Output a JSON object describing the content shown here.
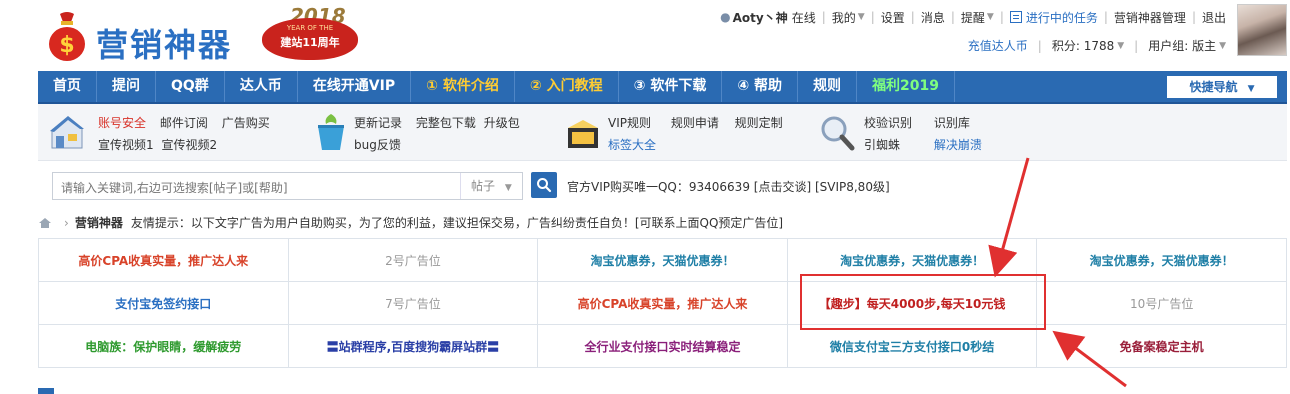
{
  "site": {
    "title": "营销神器",
    "badge_year": "2018",
    "badge_line1": "YEAR OF THE",
    "badge_line2": "建站11周年"
  },
  "topbar": {
    "username": "Aoty丶神",
    "online": "在线",
    "my": "我的",
    "settings": "设置",
    "messages": "消息",
    "remind": "提醒",
    "tasks": "进行中的任务",
    "manage": "营销神器管理",
    "logout": "退出"
  },
  "topbar2": {
    "recharge": "充值达人币",
    "points": "积分: 1788",
    "group": "用户组: 版主"
  },
  "nav": {
    "items": [
      {
        "label": "首页",
        "style": "white"
      },
      {
        "label": "提问",
        "style": "white"
      },
      {
        "label": "QQ群",
        "style": "white"
      },
      {
        "label": "达人币",
        "style": "white"
      },
      {
        "label": "在线开通VIP",
        "style": "white"
      },
      {
        "label": "① 软件介绍",
        "style": "yellow"
      },
      {
        "label": "② 入门教程",
        "style": "yellow"
      },
      {
        "label": "③ 软件下载",
        "style": "white"
      },
      {
        "label": "④ 帮助",
        "style": "white"
      },
      {
        "label": "规则",
        "style": "white"
      },
      {
        "label": "福利2019",
        "style": "green"
      }
    ],
    "quick": "快捷导航"
  },
  "subnav": {
    "g1_row1": [
      "账号安全",
      "邮件订阅",
      "广告购买"
    ],
    "g1_row2": [
      "宣传视频1",
      "宣传视频2"
    ],
    "g2_row1": [
      "更新记录",
      "完整包下载",
      "升级包"
    ],
    "g2_row2": [
      "bug反馈"
    ],
    "g3_row1": [
      "VIP规则",
      "规则申请",
      "规则定制"
    ],
    "g3_row2": [
      "标签大全"
    ],
    "g4_row1": [
      "校验识别",
      "识别库"
    ],
    "g4_row2": [
      "引蜘蛛",
      "解决崩溃"
    ]
  },
  "search": {
    "placeholder": "请输入关键词,右边可选搜索[帖子]或[帮助]",
    "type": "帖子",
    "vip_note": "官方VIP购买唯一QQ：93406639 [点击交谈] [SVIP8,80级]"
  },
  "crumb": {
    "forum": "营销神器",
    "tip": "友情提示：以下文字广告为用户自助购买，为了您的利益，建议担保交易，广告纠纷责任自负！[可联系上面QQ预定广告位]"
  },
  "ads": [
    [
      "高价CPA收真实量，推广达人来",
      "2号广告位",
      "淘宝优惠券，天猫优惠券！",
      "淘宝优惠券，天猫优惠券！",
      "淘宝优惠券，天猫优惠券！"
    ],
    [
      "支付宝免签约接口",
      "7号广告位",
      "高价CPA收真实量，推广达人来",
      "【趣步】每天4000步,每天10元钱",
      "10号广告位"
    ],
    [
      "电脑族：保护眼睛，缓解疲劳",
      "〓站群程序,百度搜狗霸屏站群〓",
      "全行业支付接口实时结算稳定",
      "微信支付宝三方支付接口0秒结",
      "免备案稳定主机"
    ]
  ],
  "colors": {
    "nav_bg": "#2a6ab2",
    "accent_red": "#e03030"
  }
}
